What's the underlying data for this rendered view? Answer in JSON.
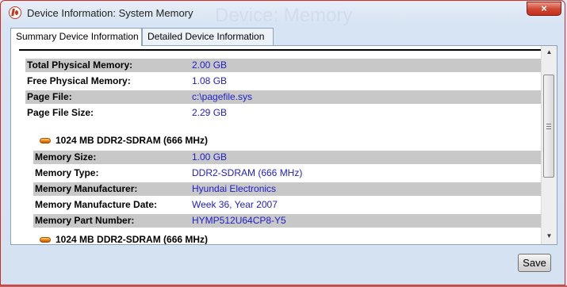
{
  "window": {
    "title": "Device Information: System Memory",
    "background_title": "Device: Memory",
    "close_glyph": "×"
  },
  "tabs": [
    {
      "label": "Summary Device Information",
      "active": true
    },
    {
      "label": "Detailed Device Information",
      "active": false
    }
  ],
  "summary_rows": [
    {
      "label": "Total Physical Memory:",
      "value": "2.00 GB",
      "shaded": true
    },
    {
      "label": "Free Physical Memory:",
      "value": "1.08 GB",
      "shaded": false
    },
    {
      "label": "Page File:",
      "value": "c:\\pagefile.sys",
      "shaded": true
    },
    {
      "label": "Page File Size:",
      "value": "2.29 GB",
      "shaded": false
    }
  ],
  "memory_modules": [
    {
      "title": "1024 MB DDR2-SDRAM (666 MHz)",
      "rows": [
        {
          "label": "Memory Size:",
          "value": "1.00 GB",
          "shaded": true
        },
        {
          "label": "Memory Type:",
          "value": "DDR2-SDRAM (666 MHz)",
          "shaded": false
        },
        {
          "label": "Memory Manufacturer:",
          "value": "Hyundai Electronics",
          "shaded": true
        },
        {
          "label": "Memory Manufacture Date:",
          "value": "Week 36, Year 2007",
          "shaded": false
        },
        {
          "label": "Memory Part Number:",
          "value": "HYMP512U64CP8-Y5",
          "shaded": true
        }
      ]
    },
    {
      "title": "1024 MB DDR2-SDRAM (666 MHz)",
      "rows": []
    }
  ],
  "scrollbar": {
    "up_arrow": "▲",
    "down_arrow": "▼"
  },
  "buttons": {
    "save_label": "Save"
  },
  "icons": {
    "app": "app-logo-icon",
    "module": "memory-module-icon"
  }
}
